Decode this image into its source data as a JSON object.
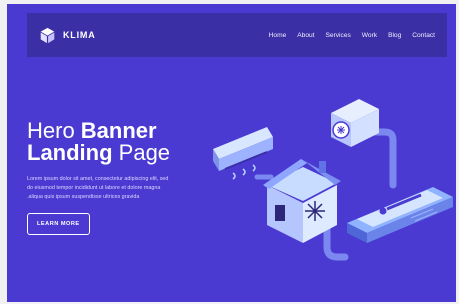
{
  "brand": {
    "name": "KLIMA",
    "logo_icon": "cube-icon"
  },
  "nav": {
    "items": [
      "Home",
      "About",
      "Services",
      "Work",
      "Blog",
      "Contact"
    ]
  },
  "hero": {
    "title_light_1": "Hero ",
    "title_bold_1": "Banner",
    "title_bold_2": "Landing",
    "title_light_2": " Page",
    "text_1": "Lorem ipsum dolor sit amet, consectetur adipiscing elit, sed",
    "text_2": "do eiusmod tempor incididunt ut labore et dolore magna",
    "text_3": ".aliqua quis ipsum suspendisse ultrices gravida",
    "cta_label": "LEARN MORE"
  },
  "colors": {
    "background": "#4a3ad2",
    "navbar": "#3b2fa6",
    "accent": "#7fb9ff"
  }
}
